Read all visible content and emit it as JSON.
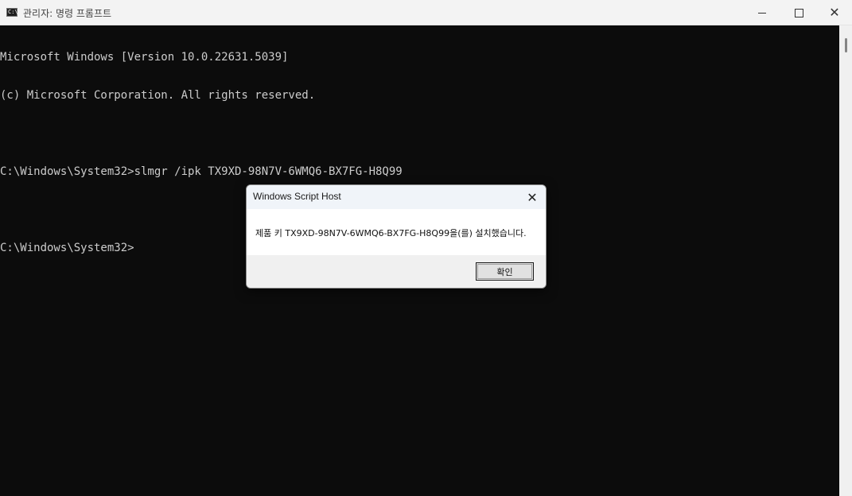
{
  "window": {
    "icon": "cmd-icon",
    "title": "관리자: 명령 프롬프트",
    "controls": [
      "minimize-icon",
      "maximize-icon",
      "close-icon"
    ]
  },
  "console": {
    "lines": [
      "Microsoft Windows [Version 10.0.22631.5039]",
      "(c) Microsoft Corporation. All rights reserved.",
      "",
      "C:\\Windows\\System32>slmgr /ipk TX9XD-98N7V-6WMQ6-BX7FG-H8Q99",
      "",
      "C:\\Windows\\System32>"
    ]
  },
  "dialog": {
    "title": "Windows Script Host",
    "message": "제품 키 TX9XD-98N7V-6WMQ6-BX7FG-H8Q99을(를) 설치했습니다.",
    "ok_label": "확인"
  }
}
